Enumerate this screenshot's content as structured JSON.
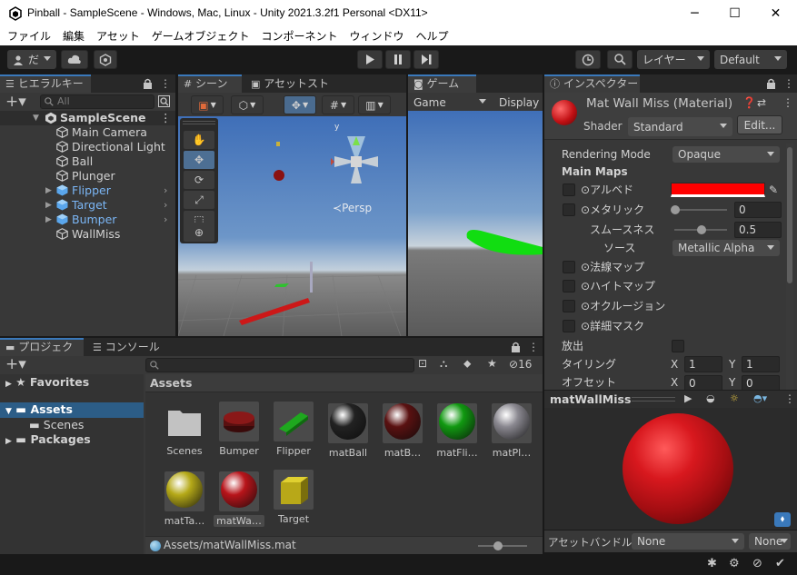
{
  "window": {
    "title": "Pinball - SampleScene - Windows, Mac, Linux - Unity 2021.3.2f1 Personal <DX11>",
    "minimize": "─",
    "maximize": "☐",
    "close": "✕"
  },
  "menu": [
    "ファイル",
    "編集",
    "アセット",
    "ゲームオブジェクト",
    "コンポーネント",
    "ウィンドウ",
    "ヘルプ"
  ],
  "toolbar": {
    "account_label": "だ",
    "layers_label": "レイヤー",
    "layout_label": "Default"
  },
  "hierarchy": {
    "tab_label": "ヒエラルキー",
    "search_placeholder": "All",
    "scene_name": "SampleScene",
    "items": [
      {
        "label": "Main Camera",
        "prefab": false
      },
      {
        "label": "Directional Light",
        "prefab": false
      },
      {
        "label": "Ball",
        "prefab": false
      },
      {
        "label": "Plunger",
        "prefab": false
      },
      {
        "label": "Flipper",
        "prefab": true
      },
      {
        "label": "Target",
        "prefab": true
      },
      {
        "label": "Bumper",
        "prefab": true
      },
      {
        "label": "WallMiss",
        "prefab": false
      }
    ]
  },
  "scene": {
    "tab_label": "シーン",
    "asset_store_tab": "アセットストア",
    "persp_label": "Persp",
    "gizmo_y": "y"
  },
  "game": {
    "tab_label": "ゲーム",
    "display_mode": "Game",
    "display_label": "Display"
  },
  "inspector": {
    "tab_label": "インスペクター",
    "material_name": "Mat Wall Miss (Material)",
    "shader_label": "Shader",
    "shader_value": "Standard",
    "edit_button": "Edit...",
    "rendering_mode_label": "Rendering Mode",
    "rendering_mode_value": "Opaque",
    "main_maps_label": "Main Maps",
    "albedo_label": "アルベド",
    "albedo_color": "#ff0000",
    "metallic_label": "メタリック",
    "metallic_value": "0",
    "smoothness_label": "スムースネス",
    "smoothness_value": "0.5",
    "source_label": "ソース",
    "source_value": "Metallic Alpha",
    "normal_map_label": "法線マップ",
    "height_map_label": "ハイトマップ",
    "occlusion_label": "オクルージョン",
    "detail_mask_label": "詳細マスク",
    "emission_label": "放出",
    "tiling_label": "タイリング",
    "tiling_x": "1",
    "tiling_y": "1",
    "offset_label": "オフセット",
    "offset_x": "0",
    "offset_y": "0",
    "x_label": "X",
    "y_label": "Y",
    "preview_title": "matWallMiss",
    "asset_bundle_label": "アセットバンドル",
    "asset_bundle_value": "None",
    "asset_bundle_variant": "None"
  },
  "project": {
    "tab_label": "プロジェクト",
    "console_tab": "コンソール",
    "hidden_count": "16",
    "favorites_label": "Favorites",
    "assets_label": "Assets",
    "scenes_label": "Scenes",
    "packages_label": "Packages",
    "header": "Assets",
    "assets": [
      {
        "label": "Scenes",
        "kind": "folder"
      },
      {
        "label": "Bumper",
        "kind": "bumper"
      },
      {
        "label": "Flipper",
        "kind": "flipper"
      },
      {
        "label": "matBall",
        "kind": "sphere",
        "color": "#222222"
      },
      {
        "label": "matB…",
        "kind": "sphere",
        "color": "#5a1111"
      },
      {
        "label": "matFli…",
        "kind": "sphere",
        "color": "#119911"
      },
      {
        "label": "matPl…",
        "kind": "sphere",
        "color": "#8a8890"
      },
      {
        "label": "matTa…",
        "kind": "sphere",
        "color": "#b5a918"
      },
      {
        "label": "matWa…",
        "kind": "sphere",
        "color": "#b8141a"
      },
      {
        "label": "Target",
        "kind": "cube"
      }
    ],
    "path": "Assets/matWallMiss.mat"
  }
}
